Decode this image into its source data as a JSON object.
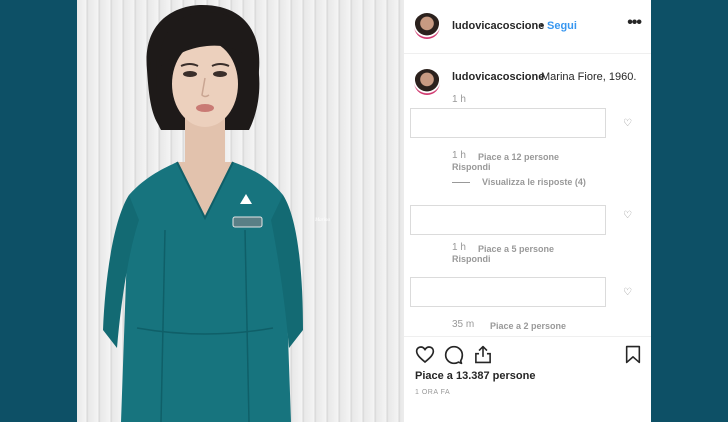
{
  "post": {
    "username": "ludovicacoscione",
    "separator": "•",
    "follow_label": "Segui",
    "more_icon": "more-options-icon",
    "caption": "Marina Fiore, 1960.",
    "caption_time": "1 h",
    "name_tag": "Marina"
  },
  "comments": [
    {
      "time": "1 h",
      "likes": "Piace a 12 persone",
      "reply": "Rispondi",
      "view_replies": "Visualizza le risposte (4)"
    },
    {
      "time": "1 h",
      "likes": "Piace a 5 persone",
      "reply": "Rispondi"
    },
    {
      "time": "35 m",
      "likes": "Piace a 2 persone"
    }
  ],
  "footer": {
    "likes_count": "Piace a 13.387 persone",
    "posted_ago": "1 ORA FA"
  },
  "icons": [
    "heart-icon",
    "comment-icon",
    "share-icon",
    "bookmark-icon",
    "comment-like-heart-icon"
  ],
  "colors": {
    "background": "#0d5066",
    "link": "#3897f0",
    "uniform": "#17747e"
  }
}
